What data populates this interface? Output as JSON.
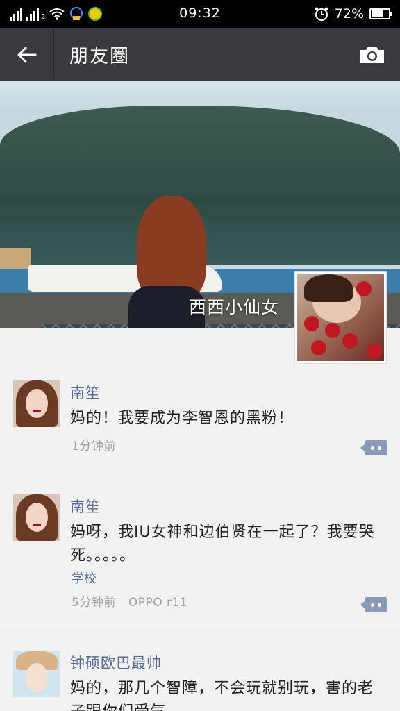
{
  "status_bar": {
    "time": "09:32",
    "battery": "72%",
    "battery_level": 0.72,
    "sim_slot": "2"
  },
  "header": {
    "title": "朋友圈"
  },
  "cover": {
    "user_name": "西西小仙女"
  },
  "posts": [
    {
      "author": "南笙",
      "content": "妈的！我要成为李智恩的黑粉！",
      "time": "1分钟前"
    },
    {
      "author": "南笙",
      "content": "妈呀，我IU女神和边伯贤在一起了？我要哭死。。。。。",
      "location": "学校",
      "time": "5分钟前",
      "device": "OPPO r11"
    },
    {
      "author": "钟硕欧巴最帅",
      "content": "妈的，那几个智障，不会玩就别玩，害的老子跟你们受气"
    }
  ],
  "colors": {
    "title_bar": "#393a3f",
    "nickname": "#576b95",
    "feed_background": "#f2f2f2"
  }
}
